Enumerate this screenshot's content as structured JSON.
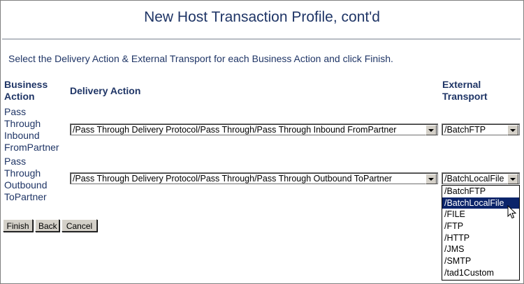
{
  "page": {
    "title": "New Host Transaction Profile, cont'd",
    "instructions": "Select the Delivery Action & External Transport for each Business Action and click Finish."
  },
  "table": {
    "headers": {
      "business_action": [
        "Business",
        "Action"
      ],
      "delivery_action": "Delivery Action",
      "external_transport": [
        "External",
        "Transport"
      ]
    },
    "rows": [
      {
        "business_action": [
          "Pass",
          "Through",
          "Inbound",
          "FromPartner"
        ],
        "delivery_action": "/Pass Through Delivery Protocol/Pass Through/Pass Through Inbound FromPartner",
        "external_transport": "/BatchFTP"
      },
      {
        "business_action": [
          "Pass",
          "Through",
          "Outbound",
          "ToPartner"
        ],
        "delivery_action": "/Pass Through Delivery Protocol/Pass Through/Pass Through Outbound ToPartner",
        "external_transport": "/BatchLocalFile"
      }
    ]
  },
  "buttons": {
    "finish": "Finish",
    "back": "Back",
    "cancel": "Cancel"
  },
  "transport_dropdown": {
    "open": true,
    "selected": "/BatchLocalFile",
    "options": [
      "/BatchFTP",
      "/BatchLocalFile",
      "/FILE",
      "/FTP",
      "/HTTP",
      "/JMS",
      "/SMTP",
      "/tad1Custom"
    ]
  },
  "colors": {
    "heading_text": "#1f3566",
    "selection_highlight": "#0a246a",
    "button_face": "#d4d0c8"
  },
  "icons": {
    "dropdown_arrow": "chevron-down-icon",
    "mouse_pointer": "arrow-cursor-icon"
  }
}
